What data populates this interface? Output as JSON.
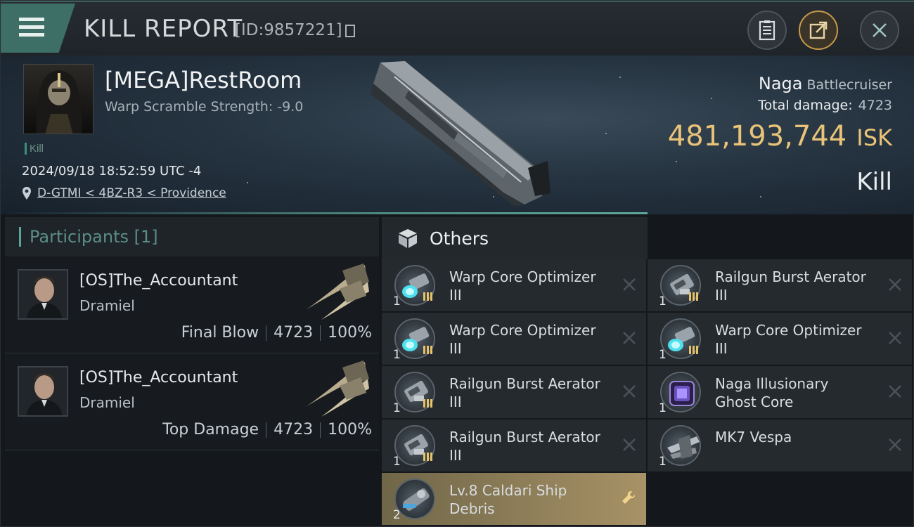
{
  "header": {
    "title": "KILL REPORT",
    "report_id": "[ID:9857221]"
  },
  "victim": {
    "pilot": "[MEGA]RestRoom",
    "warp_scramble": "Warp Scramble Strength: -9.0",
    "tag": "Kill",
    "datetime": "2024/09/18 18:52:59 UTC -4",
    "location": "D-GTMI < 4BZ-R3 < Providence",
    "ship_name": "Naga",
    "ship_class": "Battlecruiser",
    "total_damage_label": "Total damage:",
    "total_damage": "4723",
    "isk_value": "481,193,744",
    "isk_unit": "ISK",
    "result": "Kill"
  },
  "participants": {
    "label": "Participants [1]",
    "rows": [
      {
        "name": "[OS]The_Accountant",
        "ship": "Dramiel",
        "role": "Final Blow",
        "damage": "4723",
        "percent": "100%"
      },
      {
        "name": "[OS]The_Accountant",
        "ship": "Dramiel",
        "role": "Top Damage",
        "damage": "4723",
        "percent": "100%"
      }
    ]
  },
  "others": {
    "label": "Others",
    "items": [
      {
        "name": "Warp Core Optimizer III",
        "line1": "Warp Core Optimizer",
        "line2": "III",
        "qty": "1",
        "icon": "warp-core-optimizer-icon"
      },
      {
        "name": "Railgun Burst Aerator III",
        "line1": "Railgun Burst Aerator",
        "line2": "III",
        "qty": "1",
        "icon": "railgun-burst-aerator-icon"
      },
      {
        "name": "Warp Core Optimizer III",
        "line1": "Warp Core Optimizer",
        "line2": "III",
        "qty": "1",
        "icon": "warp-core-optimizer-icon"
      },
      {
        "name": "Warp Core Optimizer III",
        "line1": "Warp Core Optimizer",
        "line2": "III",
        "qty": "1",
        "icon": "warp-core-optimizer-icon"
      },
      {
        "name": "Railgun Burst Aerator III",
        "line1": "Railgun Burst Aerator",
        "line2": "III",
        "qty": "1",
        "icon": "railgun-burst-aerator-icon"
      },
      {
        "name": "Naga Illusionary Ghost Core",
        "line1": "Naga Illusionary",
        "line2": "Ghost Core",
        "qty": "1",
        "icon": "ghost-core-icon"
      },
      {
        "name": "Railgun Burst Aerator III",
        "line1": "Railgun Burst Aerator",
        "line2": "III",
        "qty": "1",
        "icon": "railgun-burst-aerator-icon"
      },
      {
        "name": "MK7 Vespa",
        "line1": "MK7  Vespa",
        "line2": "",
        "qty": "1",
        "icon": "drone-icon"
      },
      {
        "name": "Lv.8 Caldari Ship Debris",
        "line1": "Lv.8 Caldari Ship",
        "line2": "Debris",
        "qty": "2",
        "icon": "ship-debris-icon"
      }
    ]
  },
  "colors": {
    "accent": "#5aa79a",
    "isk": "#e9c377",
    "highlight": "#a89266"
  }
}
